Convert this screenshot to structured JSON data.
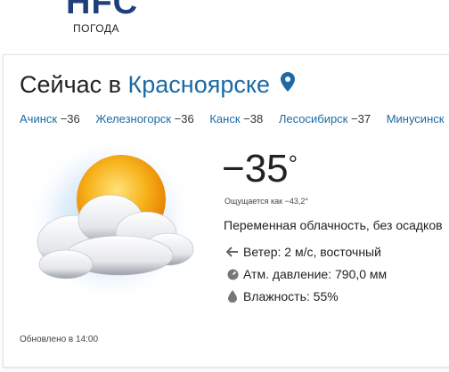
{
  "logo": {
    "text": "HFC",
    "subtitle": "ПОГОДА"
  },
  "header": {
    "prefix": "Сейчас в",
    "city": "Красноярске"
  },
  "nearby": [
    {
      "name": "Ачинск",
      "temp": "−36"
    },
    {
      "name": "Железногорск",
      "temp": "−36"
    },
    {
      "name": "Канск",
      "temp": "−38"
    },
    {
      "name": "Лесосибирск",
      "temp": "−37"
    },
    {
      "name": "Минусинск",
      "temp": ""
    }
  ],
  "weather": {
    "temp": "−35",
    "degree": "°",
    "feels_like": "Ощущается как −43,2°",
    "description": "Переменная облачность, без осадков",
    "wind": "Ветер: 2 м/с, восточный",
    "pressure": "Атм. давление: 790,0 мм",
    "humidity": "Влажность: 55%",
    "icon": "partly-cloudy-icon"
  },
  "updated": "Обновлено в 14:00",
  "colors": {
    "accent": "#1b6aa5",
    "logo": "#1f3f7a",
    "sun": "#f7a81b"
  }
}
